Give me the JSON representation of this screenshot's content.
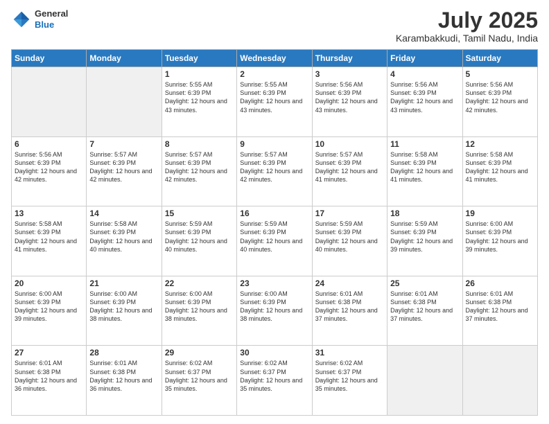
{
  "header": {
    "logo_general": "General",
    "logo_blue": "Blue",
    "month_year": "July 2025",
    "location": "Karambakkudi, Tamil Nadu, India"
  },
  "weekdays": [
    "Sunday",
    "Monday",
    "Tuesday",
    "Wednesday",
    "Thursday",
    "Friday",
    "Saturday"
  ],
  "weeks": [
    [
      {
        "day": "",
        "sunrise": "",
        "sunset": "",
        "daylight": "",
        "empty": true
      },
      {
        "day": "",
        "sunrise": "",
        "sunset": "",
        "daylight": "",
        "empty": true
      },
      {
        "day": "1",
        "sunrise": "Sunrise: 5:55 AM",
        "sunset": "Sunset: 6:39 PM",
        "daylight": "Daylight: 12 hours and 43 minutes.",
        "empty": false
      },
      {
        "day": "2",
        "sunrise": "Sunrise: 5:55 AM",
        "sunset": "Sunset: 6:39 PM",
        "daylight": "Daylight: 12 hours and 43 minutes.",
        "empty": false
      },
      {
        "day": "3",
        "sunrise": "Sunrise: 5:56 AM",
        "sunset": "Sunset: 6:39 PM",
        "daylight": "Daylight: 12 hours and 43 minutes.",
        "empty": false
      },
      {
        "day": "4",
        "sunrise": "Sunrise: 5:56 AM",
        "sunset": "Sunset: 6:39 PM",
        "daylight": "Daylight: 12 hours and 43 minutes.",
        "empty": false
      },
      {
        "day": "5",
        "sunrise": "Sunrise: 5:56 AM",
        "sunset": "Sunset: 6:39 PM",
        "daylight": "Daylight: 12 hours and 42 minutes.",
        "empty": false
      }
    ],
    [
      {
        "day": "6",
        "sunrise": "Sunrise: 5:56 AM",
        "sunset": "Sunset: 6:39 PM",
        "daylight": "Daylight: 12 hours and 42 minutes.",
        "empty": false
      },
      {
        "day": "7",
        "sunrise": "Sunrise: 5:57 AM",
        "sunset": "Sunset: 6:39 PM",
        "daylight": "Daylight: 12 hours and 42 minutes.",
        "empty": false
      },
      {
        "day": "8",
        "sunrise": "Sunrise: 5:57 AM",
        "sunset": "Sunset: 6:39 PM",
        "daylight": "Daylight: 12 hours and 42 minutes.",
        "empty": false
      },
      {
        "day": "9",
        "sunrise": "Sunrise: 5:57 AM",
        "sunset": "Sunset: 6:39 PM",
        "daylight": "Daylight: 12 hours and 42 minutes.",
        "empty": false
      },
      {
        "day": "10",
        "sunrise": "Sunrise: 5:57 AM",
        "sunset": "Sunset: 6:39 PM",
        "daylight": "Daylight: 12 hours and 41 minutes.",
        "empty": false
      },
      {
        "day": "11",
        "sunrise": "Sunrise: 5:58 AM",
        "sunset": "Sunset: 6:39 PM",
        "daylight": "Daylight: 12 hours and 41 minutes.",
        "empty": false
      },
      {
        "day": "12",
        "sunrise": "Sunrise: 5:58 AM",
        "sunset": "Sunset: 6:39 PM",
        "daylight": "Daylight: 12 hours and 41 minutes.",
        "empty": false
      }
    ],
    [
      {
        "day": "13",
        "sunrise": "Sunrise: 5:58 AM",
        "sunset": "Sunset: 6:39 PM",
        "daylight": "Daylight: 12 hours and 41 minutes.",
        "empty": false
      },
      {
        "day": "14",
        "sunrise": "Sunrise: 5:58 AM",
        "sunset": "Sunset: 6:39 PM",
        "daylight": "Daylight: 12 hours and 40 minutes.",
        "empty": false
      },
      {
        "day": "15",
        "sunrise": "Sunrise: 5:59 AM",
        "sunset": "Sunset: 6:39 PM",
        "daylight": "Daylight: 12 hours and 40 minutes.",
        "empty": false
      },
      {
        "day": "16",
        "sunrise": "Sunrise: 5:59 AM",
        "sunset": "Sunset: 6:39 PM",
        "daylight": "Daylight: 12 hours and 40 minutes.",
        "empty": false
      },
      {
        "day": "17",
        "sunrise": "Sunrise: 5:59 AM",
        "sunset": "Sunset: 6:39 PM",
        "daylight": "Daylight: 12 hours and 40 minutes.",
        "empty": false
      },
      {
        "day": "18",
        "sunrise": "Sunrise: 5:59 AM",
        "sunset": "Sunset: 6:39 PM",
        "daylight": "Daylight: 12 hours and 39 minutes.",
        "empty": false
      },
      {
        "day": "19",
        "sunrise": "Sunrise: 6:00 AM",
        "sunset": "Sunset: 6:39 PM",
        "daylight": "Daylight: 12 hours and 39 minutes.",
        "empty": false
      }
    ],
    [
      {
        "day": "20",
        "sunrise": "Sunrise: 6:00 AM",
        "sunset": "Sunset: 6:39 PM",
        "daylight": "Daylight: 12 hours and 39 minutes.",
        "empty": false
      },
      {
        "day": "21",
        "sunrise": "Sunrise: 6:00 AM",
        "sunset": "Sunset: 6:39 PM",
        "daylight": "Daylight: 12 hours and 38 minutes.",
        "empty": false
      },
      {
        "day": "22",
        "sunrise": "Sunrise: 6:00 AM",
        "sunset": "Sunset: 6:39 PM",
        "daylight": "Daylight: 12 hours and 38 minutes.",
        "empty": false
      },
      {
        "day": "23",
        "sunrise": "Sunrise: 6:00 AM",
        "sunset": "Sunset: 6:39 PM",
        "daylight": "Daylight: 12 hours and 38 minutes.",
        "empty": false
      },
      {
        "day": "24",
        "sunrise": "Sunrise: 6:01 AM",
        "sunset": "Sunset: 6:38 PM",
        "daylight": "Daylight: 12 hours and 37 minutes.",
        "empty": false
      },
      {
        "day": "25",
        "sunrise": "Sunrise: 6:01 AM",
        "sunset": "Sunset: 6:38 PM",
        "daylight": "Daylight: 12 hours and 37 minutes.",
        "empty": false
      },
      {
        "day": "26",
        "sunrise": "Sunrise: 6:01 AM",
        "sunset": "Sunset: 6:38 PM",
        "daylight": "Daylight: 12 hours and 37 minutes.",
        "empty": false
      }
    ],
    [
      {
        "day": "27",
        "sunrise": "Sunrise: 6:01 AM",
        "sunset": "Sunset: 6:38 PM",
        "daylight": "Daylight: 12 hours and 36 minutes.",
        "empty": false
      },
      {
        "day": "28",
        "sunrise": "Sunrise: 6:01 AM",
        "sunset": "Sunset: 6:38 PM",
        "daylight": "Daylight: 12 hours and 36 minutes.",
        "empty": false
      },
      {
        "day": "29",
        "sunrise": "Sunrise: 6:02 AM",
        "sunset": "Sunset: 6:37 PM",
        "daylight": "Daylight: 12 hours and 35 minutes.",
        "empty": false
      },
      {
        "day": "30",
        "sunrise": "Sunrise: 6:02 AM",
        "sunset": "Sunset: 6:37 PM",
        "daylight": "Daylight: 12 hours and 35 minutes.",
        "empty": false
      },
      {
        "day": "31",
        "sunrise": "Sunrise: 6:02 AM",
        "sunset": "Sunset: 6:37 PM",
        "daylight": "Daylight: 12 hours and 35 minutes.",
        "empty": false
      },
      {
        "day": "",
        "sunrise": "",
        "sunset": "",
        "daylight": "",
        "empty": true
      },
      {
        "day": "",
        "sunrise": "",
        "sunset": "",
        "daylight": "",
        "empty": true
      }
    ]
  ]
}
